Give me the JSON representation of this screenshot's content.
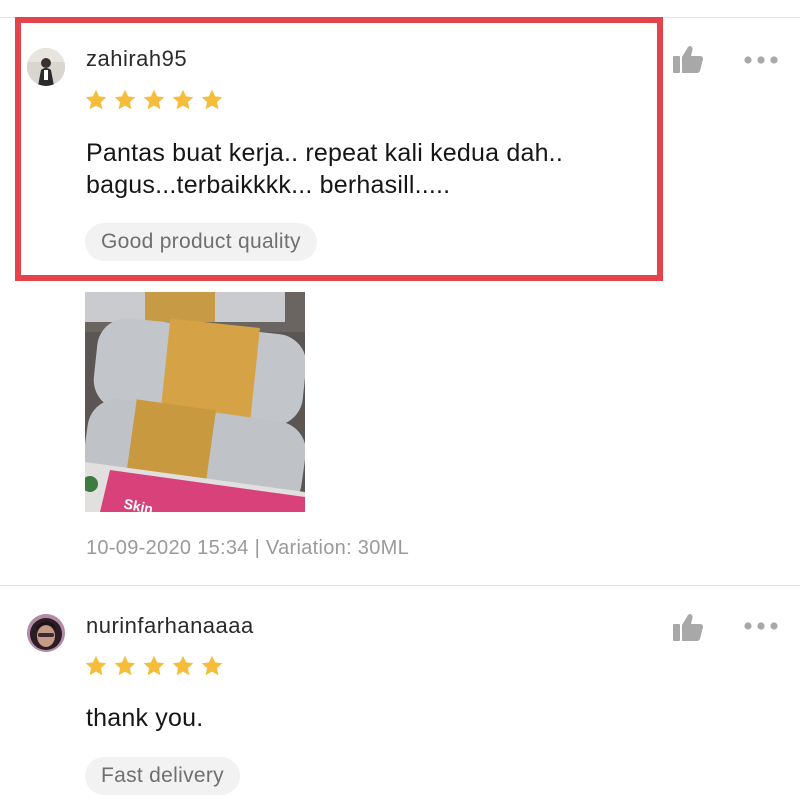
{
  "colors": {
    "star": "#f6bd3b",
    "highlight_border": "#e5434b",
    "tag_background": "#f2f2f2",
    "muted_text": "#9a9a9a",
    "icon_gray": "#a8a8a8"
  },
  "reviews": [
    {
      "username": "zahirah95",
      "rating": 5,
      "text": "Pantas buat kerja.. repeat kali kedua dah..\nbagus...terbaikkkk... berhasill.....",
      "tag": "Good product quality",
      "photo": {
        "overlay_text": "Skin"
      },
      "meta": "10-09-2020 15:34 | Variation: 30ML",
      "icons": {
        "like": "thumbs-up-icon",
        "more": "more-dots-icon"
      }
    },
    {
      "username": "nurinfarhanaaaa",
      "rating": 5,
      "text": "thank you.",
      "tag": "Fast delivery",
      "icons": {
        "like": "thumbs-up-icon",
        "more": "more-dots-icon"
      }
    }
  ]
}
